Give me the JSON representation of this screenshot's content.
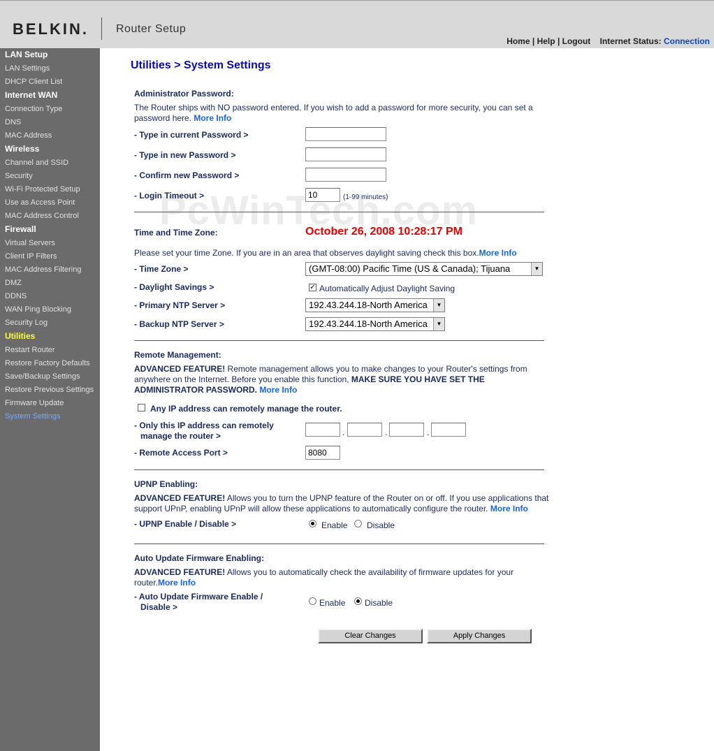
{
  "header": {
    "logo": "BELKIN.",
    "app_title": "Router Setup",
    "nav": {
      "home": "Home",
      "help": "Help",
      "logout": "Logout",
      "sep": "|",
      "status_label": "Internet Status:",
      "status_value": "Connection"
    }
  },
  "sidebar": {
    "lan_setup": "LAN Setup",
    "lan_settings": "LAN Settings",
    "dhcp_client_list": "DHCP Client List",
    "internet_wan": "Internet WAN",
    "connection_type": "Connection Type",
    "dns": "DNS",
    "mac_address": "MAC Address",
    "wireless": "Wireless",
    "channel_ssid": "Channel and SSID",
    "security": "Security",
    "wps": "Wi-Fi Protected Setup",
    "access_point": "Use as Access Point",
    "mac_control": "MAC Address Control",
    "firewall": "Firewall",
    "virtual_servers": "Virtual Servers",
    "client_ip_filters": "Client IP Filters",
    "mac_filtering": "MAC Address Filtering",
    "dmz": "DMZ",
    "ddns": "DDNS",
    "wan_ping": "WAN Ping Blocking",
    "security_log": "Security Log",
    "utilities": "Utilities",
    "restart_router": "Restart Router",
    "restore_factory": "Restore Factory Defaults",
    "save_backup": "Save/Backup Settings",
    "restore_previous": "Restore Previous Settings",
    "firmware_update": "Firmware Update",
    "system_settings": "System Settings"
  },
  "page": {
    "title": "Utilities > System Settings",
    "watermark": "PcWinTech.com",
    "admin": {
      "heading": "Administrator Password:",
      "desc_line1": "The Router ships with NO password entered. If you wish to add a password for more security, you can set a",
      "desc_line2": "password here.",
      "more_info": "More Info",
      "current_label": "- Type in current Password >",
      "new_label": "- Type in new Password >",
      "confirm_label": "- Confirm new Password >",
      "timeout_label": "- Login Timeout >",
      "timeout_value": "10",
      "timeout_hint": "(1-99 minutes)"
    },
    "time": {
      "heading": "Time and Time Zone:",
      "datetime": "October 26, 2008    10:28:17 PM",
      "desc": "Please set your time Zone. If you are in an area that observes daylight saving check this box.",
      "more_info": "More Info",
      "tz_label": "- Time Zone >",
      "tz_value": "(GMT-08:00) Pacific Time (US & Canada); Tijuana",
      "dst_label": "- Daylight Savings >",
      "dst_text": "Automatically Adjust Daylight Saving",
      "primary_label": "- Primary NTP Server >",
      "primary_value": "192.43.244.18-North America",
      "backup_label": "- Backup NTP Server >",
      "backup_value": "192.43.244.18-North America"
    },
    "remote": {
      "heading": "Remote Management:",
      "adv": "ADVANCED FEATURE!",
      "desc_line1": " Remote management allows you to make changes to your Router's settings from",
      "desc_line2a": "anywhere on the Internet. Before you enable this function, ",
      "desc_line2b": "MAKE SURE YOU HAVE SET THE",
      "desc_line3": "ADMINISTRATOR PASSWORD.",
      "more_info": "More Info",
      "any_ip": "Any IP address can remotely manage the router.",
      "only_ip_line1": "- Only this IP address can remotely",
      "only_ip_line2": "manage the router >",
      "port_label": "- Remote Access Port >",
      "port_value": "8080",
      "ip_dot": "."
    },
    "upnp": {
      "heading": "UPNP Enabling:",
      "adv": "ADVANCED FEATURE!",
      "desc_line1": " Allows you to turn the UPNP feature of the Router on or off. If you use applications that",
      "desc_line2": "support UPnP, enabling UPnP will allow these applications to automatically configure the router.",
      "more_info": "More Info",
      "label": "- UPNP Enable / Disable >",
      "enable": "Enable",
      "disable": "Disable"
    },
    "auto_update": {
      "heading": "Auto Update Firmware Enabling:",
      "adv": "ADVANCED FEATURE!",
      "desc_line1": " Allows you to automatically check the availability of firmware updates for your",
      "desc_line2": "router.",
      "more_info": "More Info",
      "label_line1": "- Auto Update Firmware Enable /",
      "label_line2": "Disable >",
      "enable": "Enable",
      "disable": "Disable"
    },
    "buttons": {
      "clear": "Clear Changes",
      "apply": "Apply Changes"
    }
  }
}
